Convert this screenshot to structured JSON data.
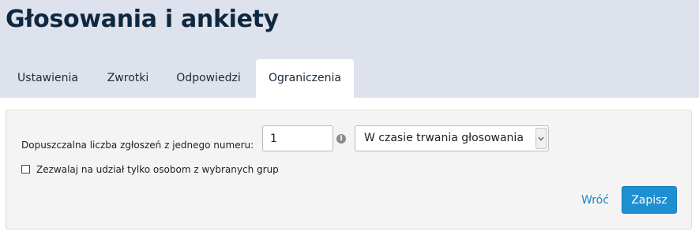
{
  "header": {
    "title": "Głosowania i ankiety"
  },
  "tabs": [
    {
      "label": "Ustawienia",
      "active": false
    },
    {
      "label": "Zwrotki",
      "active": false
    },
    {
      "label": "Odpowiedzi",
      "active": false
    },
    {
      "label": "Ograniczenia",
      "active": true
    }
  ],
  "limits": {
    "count_label": "Dopuszczalna liczba zgłoszeń z jednego numeru:",
    "count_value": "1",
    "info_icon": "info-circle-icon",
    "period_value": "W czasie trwania głosowania",
    "groups_checkbox_label": "Zezwalaj na udział tylko osobom z wybranych grup",
    "groups_checked": false
  },
  "actions": {
    "back_label": "Wróć",
    "save_label": "Zapisz"
  },
  "colors": {
    "header_bg": "#dde2ec",
    "title": "#0f2840",
    "link": "#1e84c6",
    "primary_button": "#1e8fd2"
  }
}
